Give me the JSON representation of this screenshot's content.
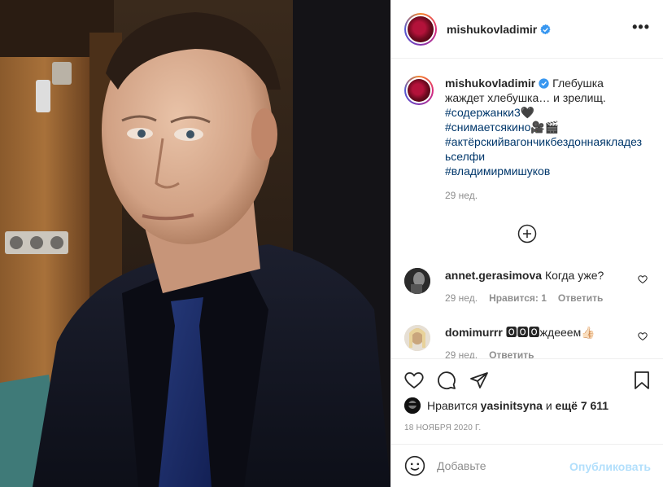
{
  "post": {
    "username": "mishukovladimir",
    "more_icon": "more-horizontal-icon",
    "caption": {
      "text": "Глебушка жаждет хлебушка… и зрелищ.",
      "tags": [
        "#содержанки3🖤",
        "#снимаетсякино🎥🎬",
        "#актёрскийвагончикбездоннаякладезьселфи",
        "#владимирмишуков"
      ],
      "time": "29 нед."
    },
    "comments": [
      {
        "username": "annet.gerasimova",
        "text": "Когда уже?",
        "time": "29 нед.",
        "likes": "Нравится: 1",
        "reply": "Ответить"
      },
      {
        "username": "domimurrr",
        "text": "🅾🅾🅾ждееем👍🏻",
        "time": "29 нед.",
        "reply": "Ответить"
      }
    ],
    "likes": {
      "prefix": "Нравится",
      "user": "yasinitsyna",
      "middle": "и",
      "rest": "ещё 7 611"
    },
    "date": "18 ноября 2020 г.",
    "add_comment": {
      "placeholder": "Добавьте",
      "publish": "Опубликовать"
    }
  },
  "colors": {
    "link": "#00376b",
    "verified": "#3897f0",
    "publish_disabled": "#b2dffc",
    "muted": "#8e8e8e"
  }
}
